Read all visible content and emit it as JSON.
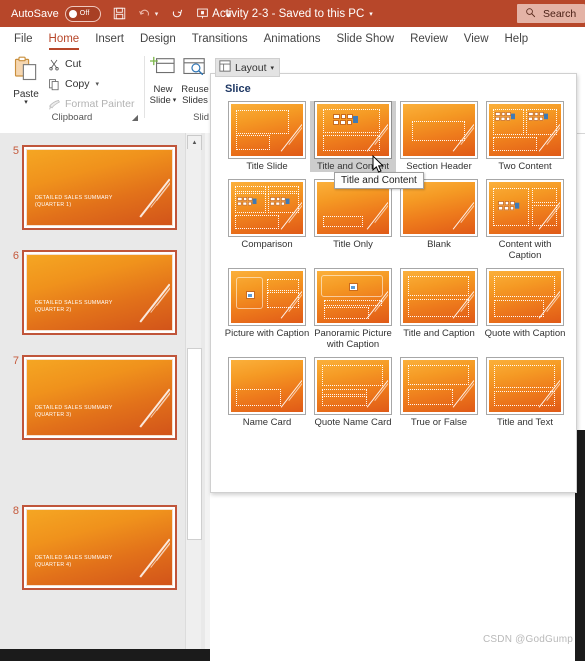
{
  "titlebar": {
    "autosave_label": "AutoSave",
    "autosave_state": "Off",
    "doc_title": "Activity 2-3  -  Saved to this PC",
    "icons": [
      "save-icon",
      "undo-icon",
      "redo-icon",
      "start-slideshow-icon",
      "customize-quick-access-icon"
    ],
    "search_placeholder": "Search",
    "bar_color": "#b7472a"
  },
  "tabs": [
    {
      "label": "File",
      "active": false
    },
    {
      "label": "Home",
      "active": true
    },
    {
      "label": "Insert",
      "active": false
    },
    {
      "label": "Design",
      "active": false
    },
    {
      "label": "Transitions",
      "active": false
    },
    {
      "label": "Animations",
      "active": false
    },
    {
      "label": "Slide Show",
      "active": false
    },
    {
      "label": "Review",
      "active": false
    },
    {
      "label": "View",
      "active": false
    },
    {
      "label": "Help",
      "active": false
    }
  ],
  "ribbon": {
    "clipboard": {
      "group_label": "Clipboard",
      "paste_label": "Paste",
      "cut_label": "Cut",
      "copy_label": "Copy",
      "format_painter_label": "Format Painter"
    },
    "slides": {
      "group_label": "Slid",
      "group_label_full": "Slides",
      "new_slide_line1": "New",
      "new_slide_line2": "Slide",
      "reuse_line1": "Reuse",
      "reuse_line2": "Slides"
    },
    "layout_button": {
      "label": "Layout",
      "caret": "ˇ"
    }
  },
  "slide_panel": {
    "slides": [
      {
        "number": "5",
        "title_line1": "DETAILED SALES SUMMARY",
        "title_line2": "(QUARTER 1)"
      },
      {
        "number": "6",
        "title_line1": "DETAILED SALES SUMMARY",
        "title_line2": "(QUARTER 2)"
      },
      {
        "number": "7",
        "title_line1": "DETAILED SALES SUMMARY",
        "title_line2": "(QUARTER 3)"
      },
      {
        "number": "8",
        "title_line1": "DETAILED SALES SUMMARY",
        "title_line2": "(QUARTER 4)"
      }
    ]
  },
  "layout_gallery": {
    "theme_name": "Slice",
    "selected": "Title and Content",
    "tooltip": "Title and Content",
    "items": [
      {
        "label": "Title Slide",
        "kind": "title-slide"
      },
      {
        "label": "Title and Content",
        "kind": "title-and-content"
      },
      {
        "label": "Section Header",
        "kind": "section-header"
      },
      {
        "label": "Two Content",
        "kind": "two-content"
      },
      {
        "label": "Comparison",
        "kind": "comparison"
      },
      {
        "label": "Title Only",
        "kind": "title-only"
      },
      {
        "label": "Blank",
        "kind": "blank"
      },
      {
        "label": "Content with Caption",
        "kind": "content-with-caption"
      },
      {
        "label": "Picture with Caption",
        "kind": "picture-with-caption"
      },
      {
        "label": "Panoramic Picture with Caption",
        "kind": "panoramic-picture-with-caption"
      },
      {
        "label": "Title and Caption",
        "kind": "title-and-caption"
      },
      {
        "label": "Quote with Caption",
        "kind": "quote-with-caption"
      },
      {
        "label": "Name Card",
        "kind": "name-card"
      },
      {
        "label": "Quote Name Card",
        "kind": "quote-name-card"
      },
      {
        "label": "True or False",
        "kind": "true-or-false"
      },
      {
        "label": "Title and Text",
        "kind": "title-and-text"
      }
    ]
  },
  "watermark": "CSDN @GodGump"
}
